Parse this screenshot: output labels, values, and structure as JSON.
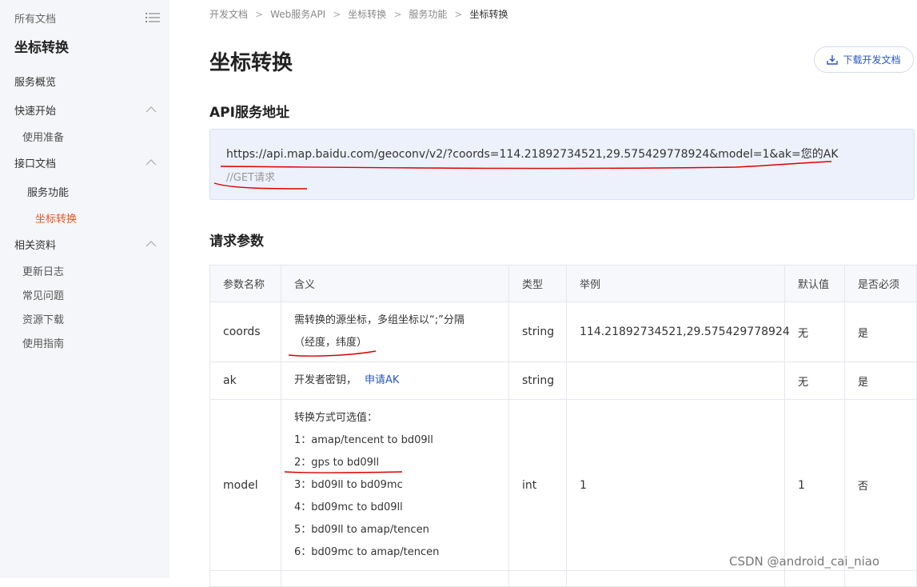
{
  "sidebar": {
    "all_docs": "所有文档",
    "title": "坐标转换",
    "items": [
      {
        "label": "服务概览"
      },
      {
        "label": "快速开始"
      },
      {
        "label": "使用准备"
      },
      {
        "label": "接口文档"
      },
      {
        "label": "服务功能"
      },
      {
        "label": "坐标转换"
      },
      {
        "label": "相关资料"
      },
      {
        "label": "更新日志"
      },
      {
        "label": "常见问题"
      },
      {
        "label": "资源下载"
      },
      {
        "label": "使用指南"
      }
    ]
  },
  "breadcrumb": [
    "开发文档",
    "Web服务API",
    "坐标转换",
    "服务功能",
    "坐标转换"
  ],
  "page": {
    "title": "坐标转换",
    "download_label": "下载开发文档"
  },
  "api": {
    "heading": "API服务地址",
    "url": "https://api.map.baidu.com/geoconv/v2/?coords=114.21892734521,29.575429778924&model=1&ak=您的AK",
    "comment": "//GET请求"
  },
  "params": {
    "heading": "请求参数",
    "columns": [
      "参数名称",
      "含义",
      "类型",
      "举例",
      "默认值",
      "是否必须"
    ],
    "rows": [
      {
        "name": "coords",
        "desc_lines": [
          "需转换的源坐标，多组坐标以“;”分隔",
          "（经度，纬度）"
        ],
        "type": "string",
        "example": "114.21892734521,29.575429778924",
        "default": "无",
        "required": "是"
      },
      {
        "name": "ak",
        "desc": "开发者密钥，",
        "desc_link": "申请AK",
        "type": "string",
        "example": "",
        "default": "无",
        "required": "是"
      },
      {
        "name": "model",
        "desc_lines": [
          "转换方式可选值：",
          "1：amap/tencent to bd09ll",
          "2：gps to bd09ll",
          "3：bd09ll to bd09mc",
          "4：bd09mc to bd09ll",
          "5：bd09ll to amap/tencen",
          "6：bd09mc to amap/tencen"
        ],
        "type": "int",
        "example": "1",
        "default": "1",
        "required": "否"
      }
    ]
  },
  "watermark": "CSDN @android_cai_niao",
  "colors": {
    "accent": "#2a55c8",
    "active": "#e8541e",
    "annotation": "#dd0000"
  }
}
